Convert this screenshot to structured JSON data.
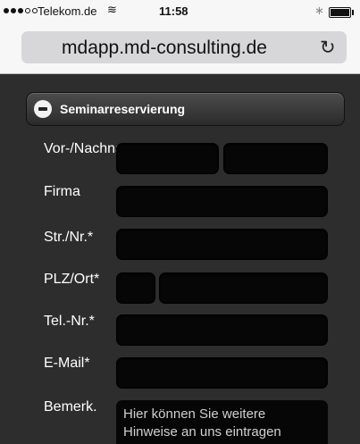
{
  "status_bar": {
    "carrier": "Telekom.de",
    "time": "11:58"
  },
  "browser": {
    "url": "mdapp.md-consulting.de"
  },
  "section": {
    "title": "Seminarreservierung"
  },
  "form": {
    "name_label": "Vor-/Nachname*",
    "company_label": "Firma",
    "street_label": "Str./Nr.*",
    "zip_city_label": "PLZ/Ort*",
    "phone_label": "Tel.-Nr.*",
    "email_label": "E-Mail*",
    "remarks_label": "Bemerk.",
    "remarks_placeholder": "Hier können Sie weitere Hinweise an uns eintragen"
  }
}
